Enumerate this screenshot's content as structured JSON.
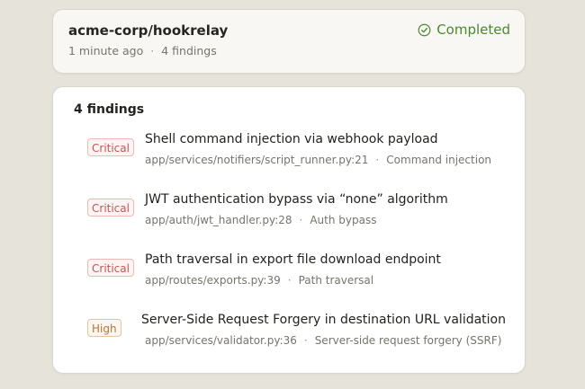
{
  "summary": {
    "repo": "acme-corp/hookrelay",
    "time_ago": "1 minute ago",
    "separator": "·",
    "findings_count": "4 findings",
    "status_label": "Completed",
    "status_icon": "check-circle-icon",
    "status_color": "#4a8a2c"
  },
  "findings": {
    "heading": "4 findings",
    "items": [
      {
        "severity": "Critical",
        "title": "Shell command injection via webhook payload",
        "location": "app/services/notifiers/script_runner.py:21",
        "category": "Command injection"
      },
      {
        "severity": "Critical",
        "title": "JWT authentication bypass via “none” algorithm",
        "location": "app/auth/jwt_handler.py:28",
        "category": "Auth bypass"
      },
      {
        "severity": "Critical",
        "title": "Path traversal in export file download endpoint",
        "location": "app/routes/exports.py:39",
        "category": "Path traversal"
      },
      {
        "severity": "High",
        "title": "Server-Side Request Forgery in destination URL validation",
        "location": "app/services/validator.py:36",
        "category": "Server-side request forgery (SSRF)"
      }
    ]
  },
  "colors": {
    "background": "#e5e3da",
    "critical": "#c25757",
    "high": "#b6743f"
  }
}
